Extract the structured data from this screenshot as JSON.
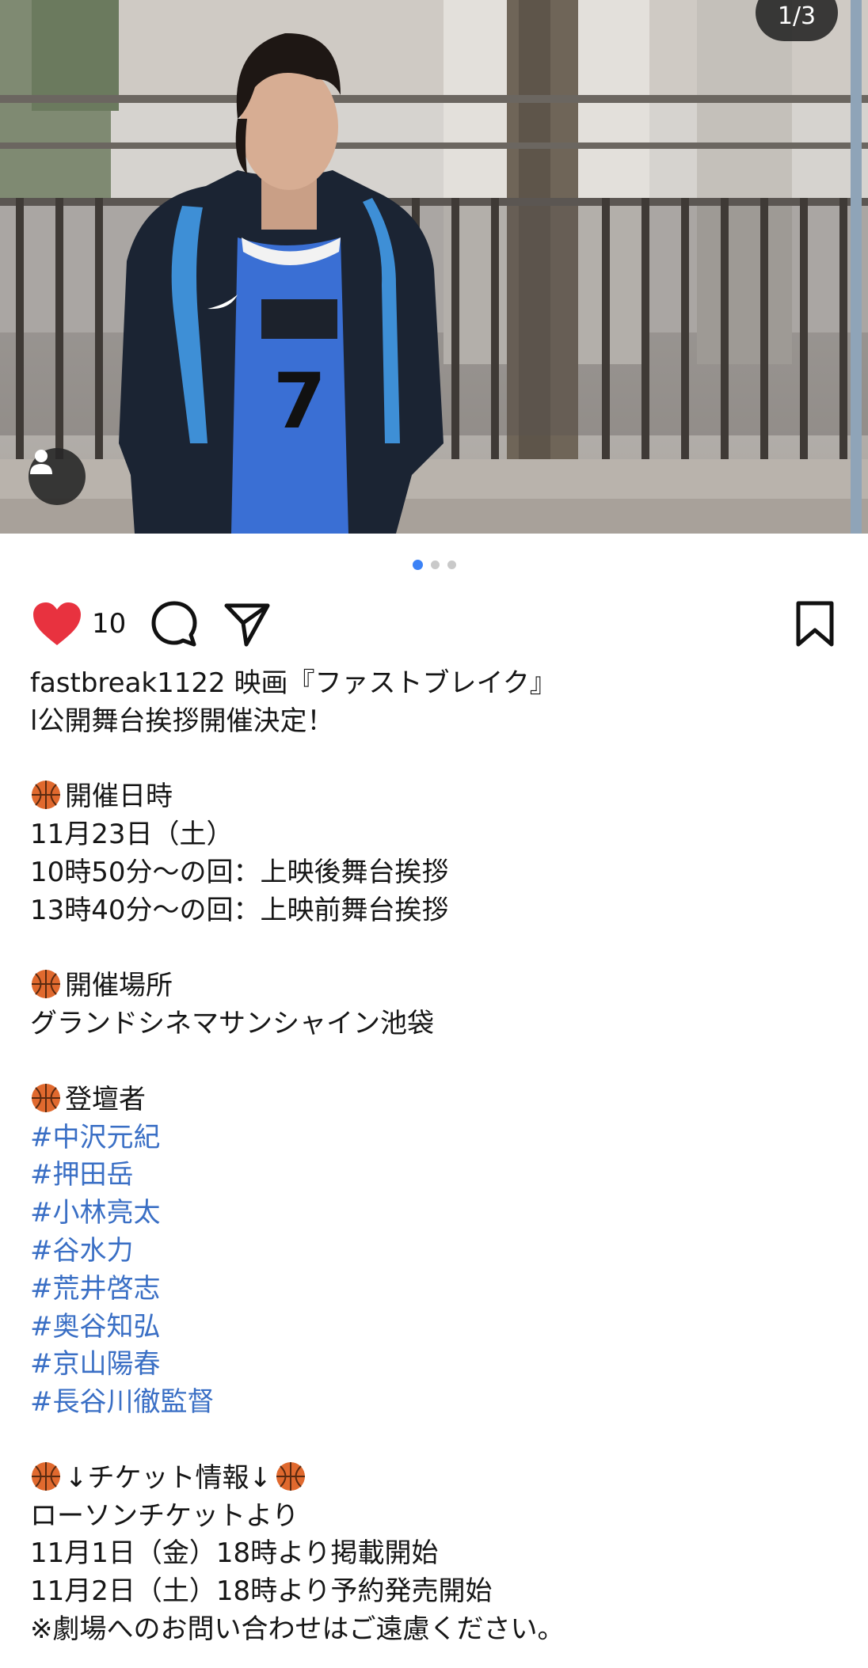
{
  "post": {
    "image_counter": "1/3",
    "dot_count": 3,
    "active_dot": 1
  },
  "actions": {
    "likes": "10",
    "liked": true,
    "icons": [
      "heart-icon",
      "comment-icon",
      "share-icon",
      "bookmark-icon"
    ]
  },
  "caption": {
    "username": "fastbreak1122",
    "line1_rest": " 映画『ファストブレイク』",
    "line2": "l公開舞台挨拶開催決定！",
    "section_date_title": "開催日時",
    "date_line": "11月23日（土）",
    "time_line1": "10時50分〜の回：上映後舞台挨拶",
    "time_line2": "13時40分〜の回：上映前舞台挨拶",
    "section_venue_title": "開催場所",
    "venue": "グランドシネマサンシャイン池袋",
    "section_cast_title": "登壇者",
    "hashtags": [
      "#中沢元紀",
      "#押田岳",
      "#小林亮太",
      "#谷水力",
      "#荒井啓志",
      "#奥谷知弘",
      "#京山陽春",
      "#長谷川徹監督"
    ],
    "ticket_title": "↓チケット情報↓",
    "ticket_source": "ローソンチケットより",
    "ticket_line1": "11月1日（金）18時より掲載開始",
    "ticket_line2": "11月2日（土）18時より予約発売開始",
    "notice": "※劇場へのお問い合わせはご遠慮ください。"
  },
  "colors": {
    "heart": "#e8323f",
    "hashtag": "#3a6fc5",
    "active_dot": "#3b82f6",
    "emoji_ball": "#e0692e"
  }
}
